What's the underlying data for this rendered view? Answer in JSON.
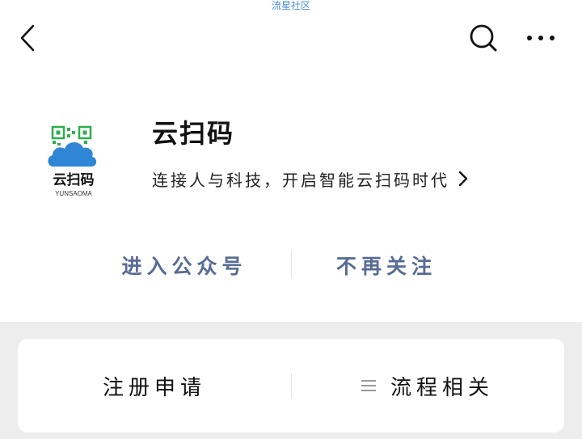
{
  "watermark": "流星社区",
  "header": {
    "back_icon": "chevron-left-icon",
    "search_icon": "search-icon",
    "more_icon": "more-dots-icon"
  },
  "account": {
    "logo_text": "云扫码",
    "logo_subtext": "YUNSAOMA",
    "name": "云扫码",
    "description": "连接人与科技，开启智能云扫码时代"
  },
  "actions": {
    "enter_label": "进入公众号",
    "unfollow_label": "不再关注"
  },
  "menu": {
    "items": [
      {
        "label": "注册申请",
        "has_submenu": false
      },
      {
        "label": "流程相关",
        "has_submenu": true,
        "icon": "menu-lines-icon"
      }
    ]
  },
  "colors": {
    "link_blue": "#576b95",
    "logo_blue": "#2f86d6",
    "logo_green": "#2fae4d",
    "bottom_bg": "#ededed"
  }
}
